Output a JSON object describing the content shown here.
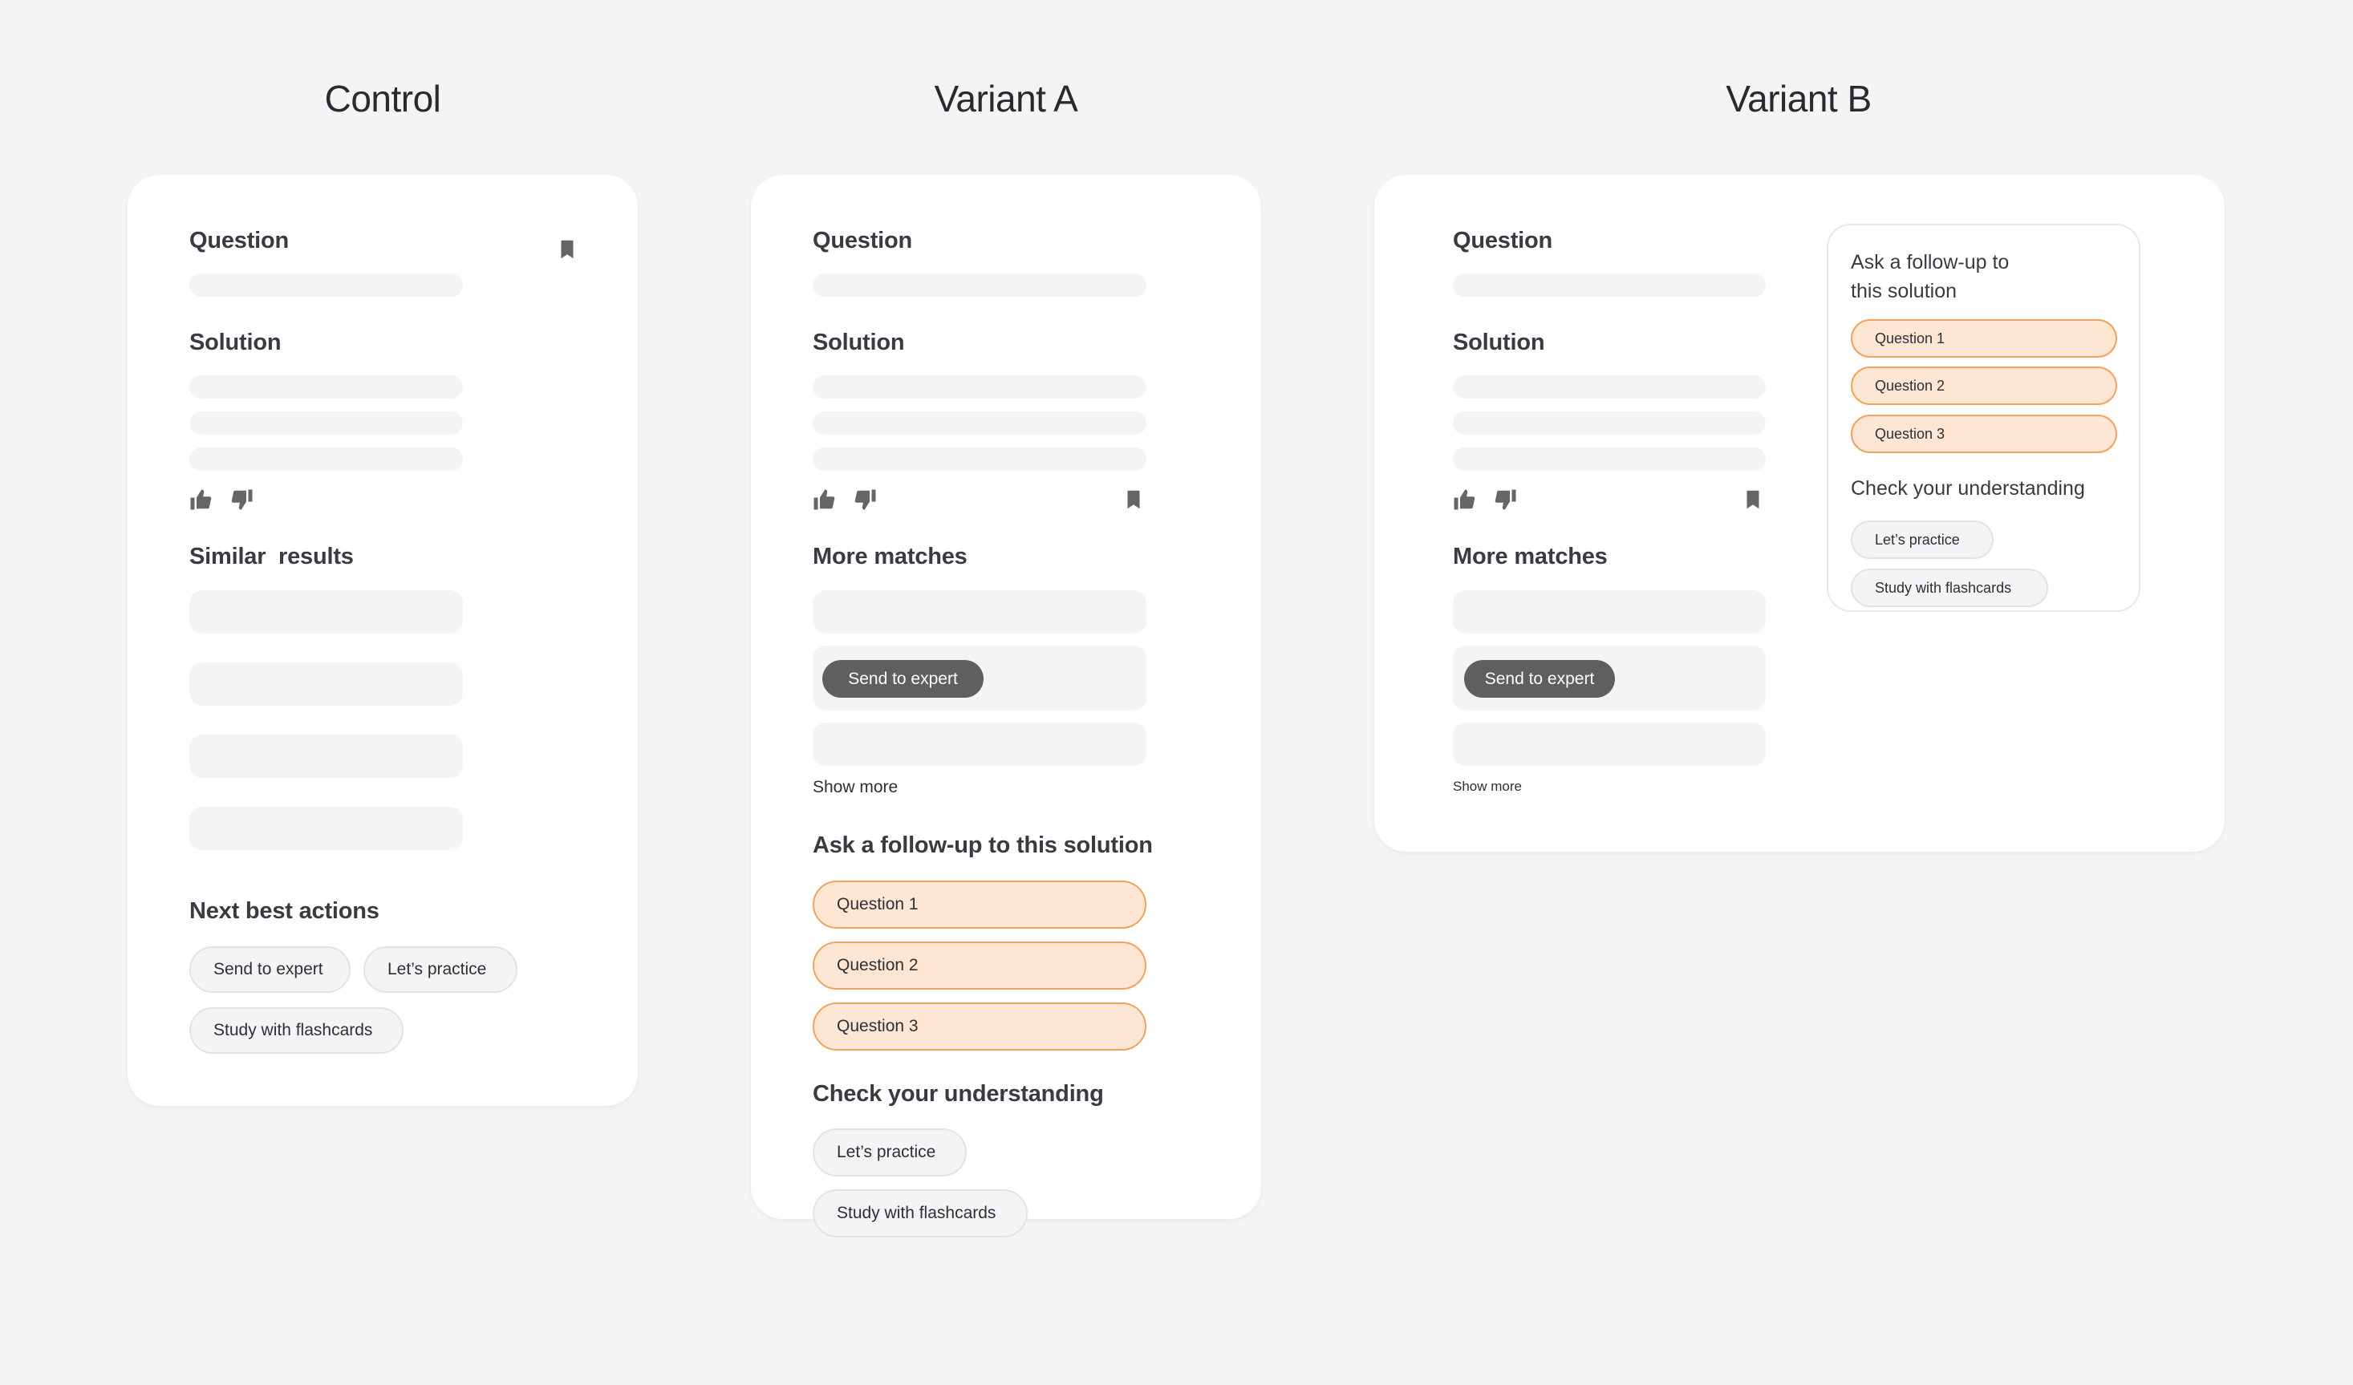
{
  "columns": {
    "control": {
      "title": "Control"
    },
    "variant_a": {
      "title": "Variant A"
    },
    "variant_b": {
      "title": "Variant B"
    }
  },
  "control": {
    "question_heading": "Question",
    "solution_heading": "Solution",
    "similar_heading": "Similar  results",
    "next_actions_heading": "Next best actions",
    "actions": [
      "Send to expert",
      "Let’s practice",
      "Study with flashcards"
    ],
    "icons": [
      "bookmark-icon",
      "thumbs-up-icon",
      "thumbs-down-icon"
    ]
  },
  "variant_a": {
    "question_heading": "Question",
    "solution_heading": "Solution",
    "more_matches_heading": "More matches",
    "send_expert_label": "Send to expert",
    "show_more_label": "Show more",
    "followup_heading": "Ask a follow-up to this solution",
    "followup_questions": [
      "Question 1",
      "Question 2",
      "Question 3"
    ],
    "check_heading": "Check your understanding",
    "check_actions": [
      "Let’s practice",
      "Study with flashcards"
    ],
    "icons": [
      "thumbs-up-icon",
      "thumbs-down-icon",
      "bookmark-icon"
    ]
  },
  "variant_b": {
    "question_heading": "Question",
    "solution_heading": "Solution",
    "more_matches_heading": "More matches",
    "send_expert_label": "Send to expert",
    "show_more_label": "Show more",
    "panel": {
      "followup_heading_line1": "Ask a follow-up to",
      "followup_heading_line2": "this solution",
      "followup_questions": [
        "Question 1",
        "Question 2",
        "Question 3"
      ],
      "check_heading": "Check your understanding",
      "check_actions": [
        "Let’s practice",
        "Study with flashcards"
      ]
    },
    "icons": [
      "thumbs-up-icon",
      "thumbs-down-icon",
      "bookmark-icon"
    ]
  },
  "colors": {
    "background": "#F4F4F6",
    "card": "#FFFFFF",
    "placeholder": "#F4F4F6",
    "followup_fill": "#FDE6D3",
    "followup_border": "#F2A35E",
    "dark_button": "#5F5F5F",
    "icon": "#666666"
  }
}
